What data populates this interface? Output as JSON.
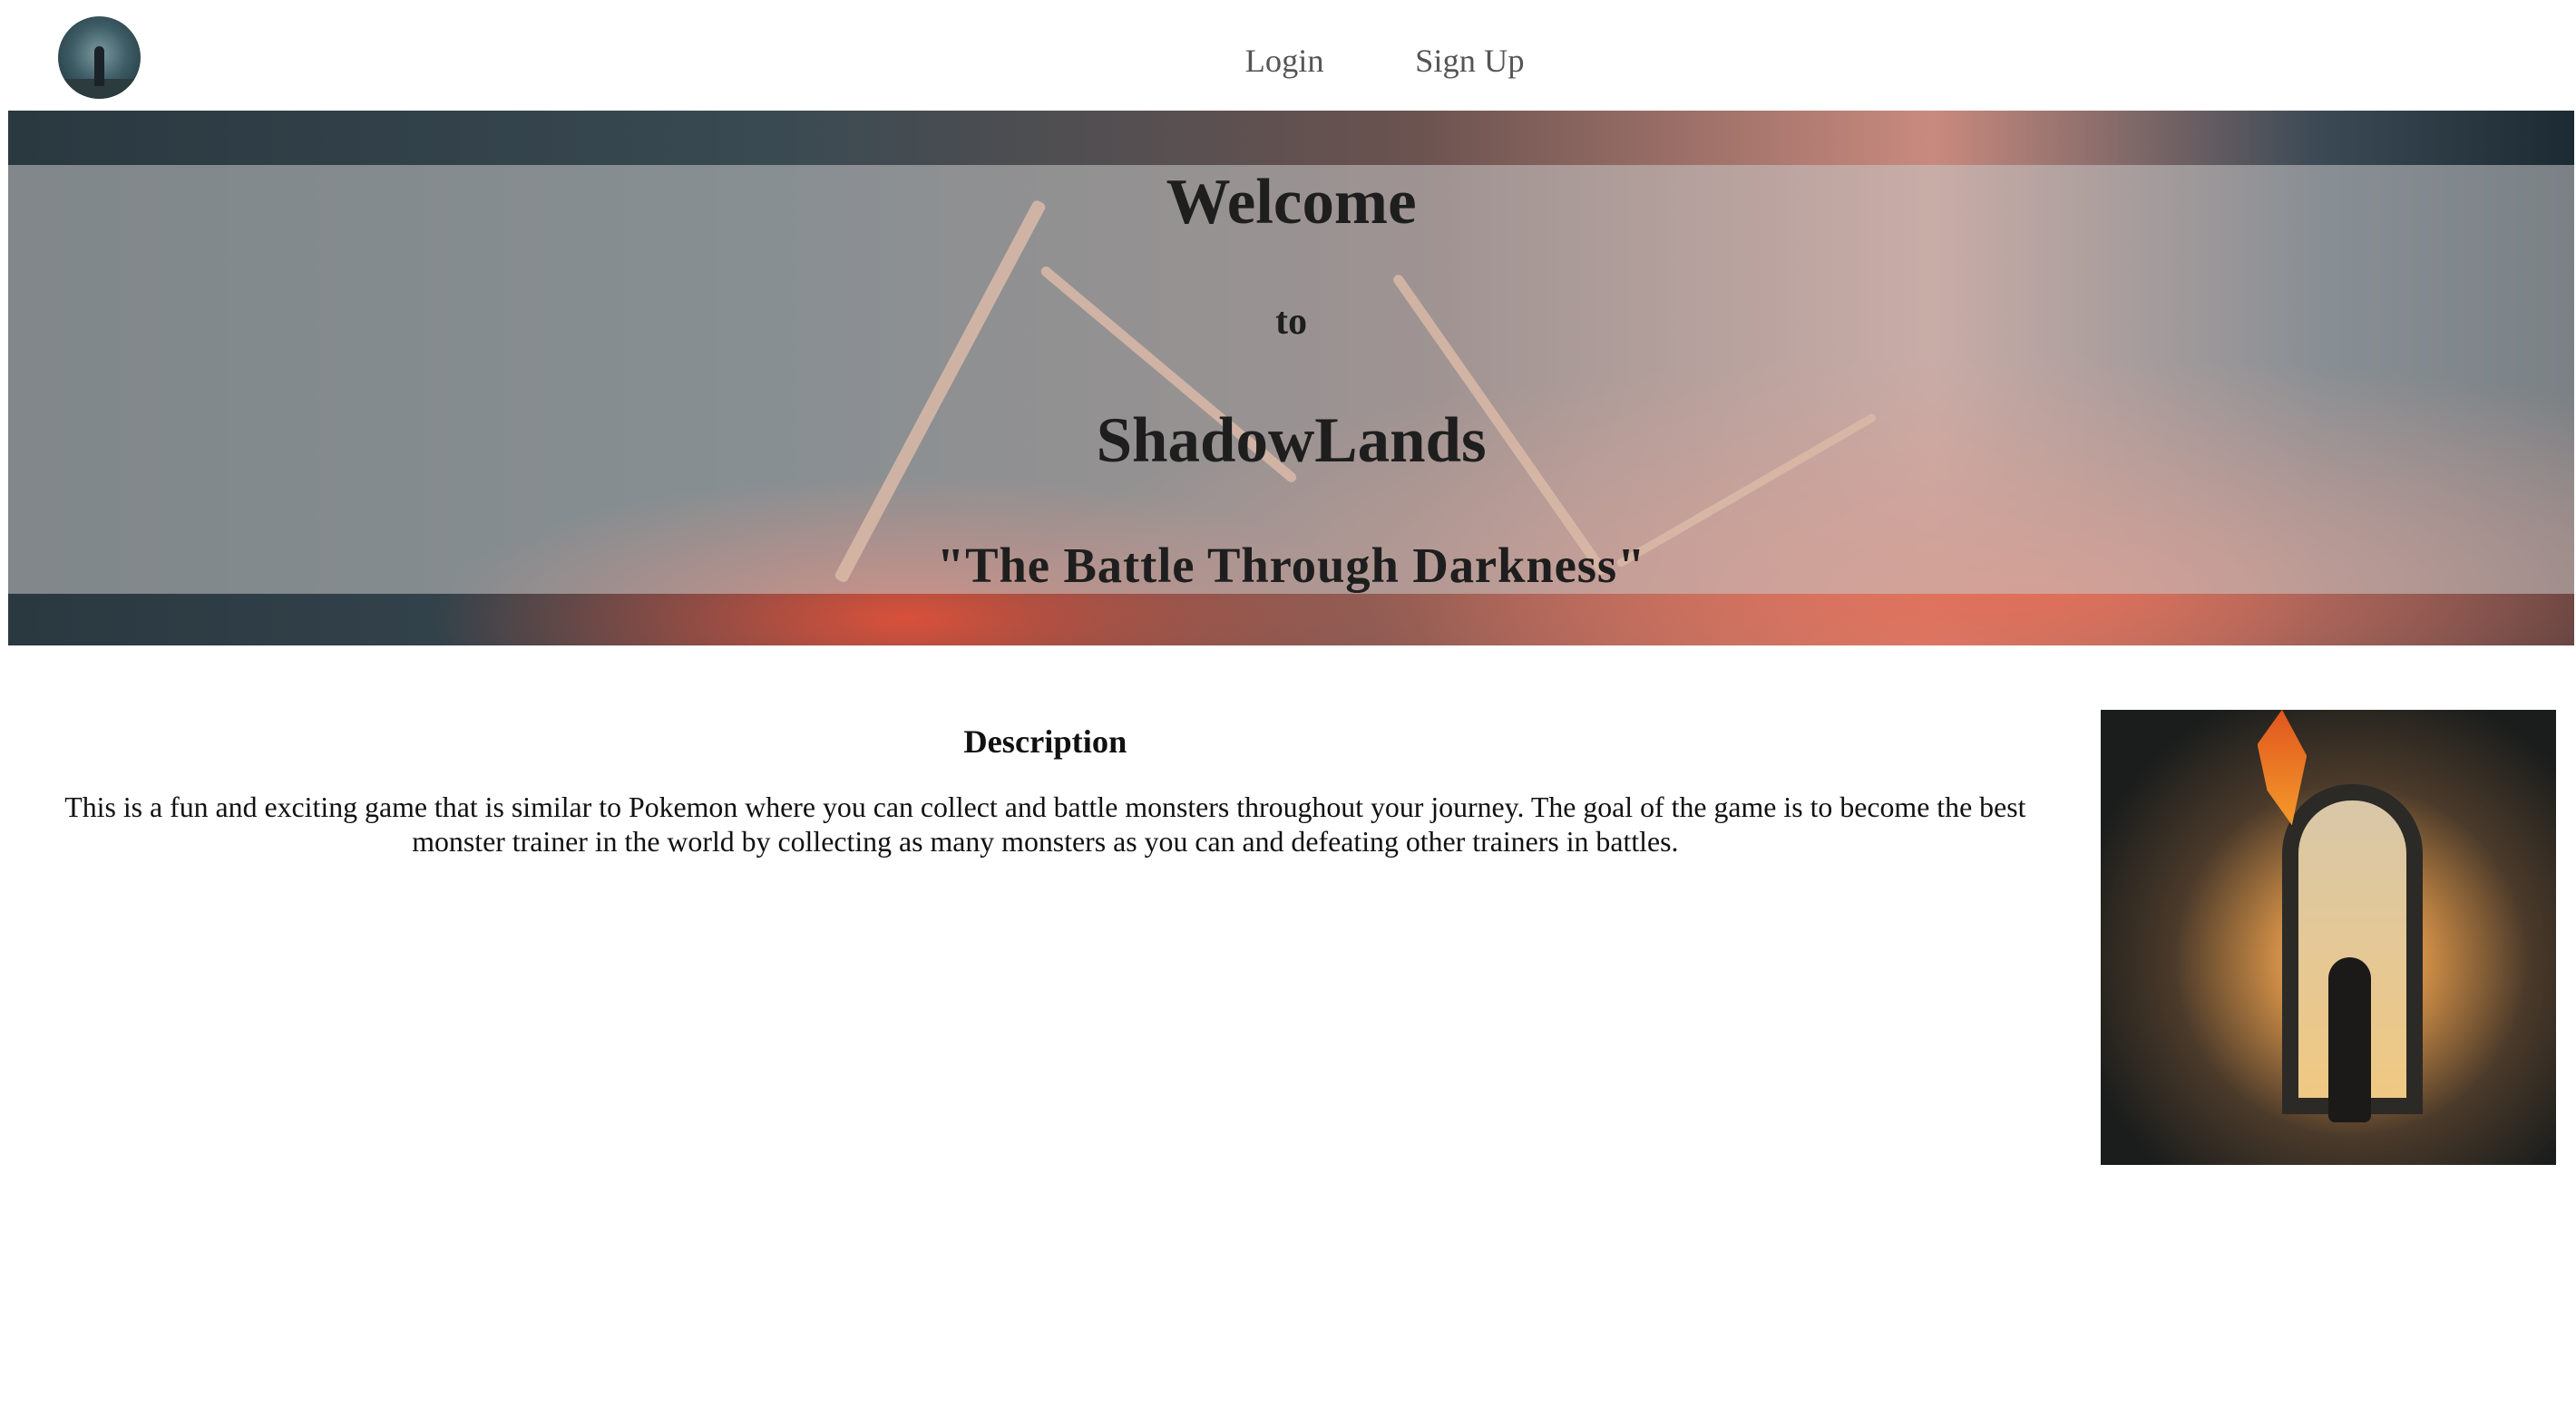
{
  "nav": {
    "logo_alt": "ShadowLands logo",
    "links": [
      {
        "label": "Login"
      },
      {
        "label": "Sign Up"
      }
    ]
  },
  "hero": {
    "line1": "Welcome",
    "line2": "to",
    "title": "ShadowLands",
    "tagline": "\"The Battle Through Darkness\""
  },
  "description": {
    "heading": "Description",
    "body": "This is a fun and exciting game that is similar to Pokemon where you can collect and battle monsters throughout your journey. The goal of the game is to become the best monster trainer in the world by collecting as many monsters as you can and defeating other trainers in battles."
  },
  "colors": {
    "nav_link": "#555555",
    "text": "#1e1e1e",
    "banner_band": "rgba(200,200,200,0.55)"
  }
}
